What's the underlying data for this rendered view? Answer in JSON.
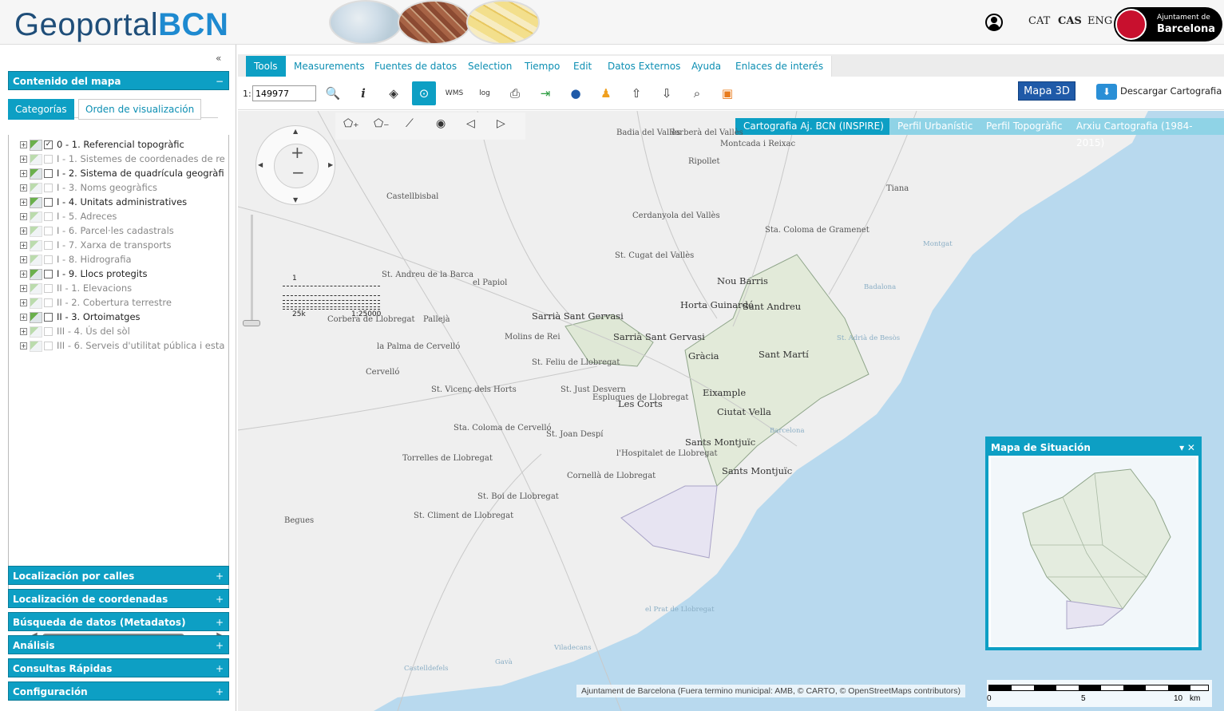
{
  "header": {
    "logo_part1": "Geoportal",
    "logo_part2": "BCN",
    "languages": [
      "CAT",
      "CAS",
      "ENG"
    ],
    "ajuntament_line1": "Ajuntament de",
    "ajuntament_line2": "Barcelona",
    "collapse_left": "«",
    "collapse_top": "︽"
  },
  "sidebar": {
    "contenido_title": "Contenido del mapa",
    "contenido_toggle": "−",
    "tabs": [
      "Categorías",
      "Orden de visualización"
    ],
    "layers": [
      {
        "label": "0 - 1. Referencial topogràfic",
        "checked": true,
        "enabled": true
      },
      {
        "label": "I - 1. Sistemes de coordenades de re",
        "checked": false,
        "enabled": false
      },
      {
        "label": "I - 2. Sistema de quadrícula geogràfi",
        "checked": false,
        "enabled": true
      },
      {
        "label": "I - 3. Noms geogràfics",
        "checked": false,
        "enabled": false
      },
      {
        "label": "I - 4. Unitats administratives",
        "checked": false,
        "enabled": true
      },
      {
        "label": "I - 5. Adreces",
        "checked": false,
        "enabled": false
      },
      {
        "label": "I - 6. Parcel·les cadastrals",
        "checked": false,
        "enabled": false
      },
      {
        "label": "I - 7. Xarxa de transports",
        "checked": false,
        "enabled": false
      },
      {
        "label": "I - 8. Hidrografia",
        "checked": false,
        "enabled": false
      },
      {
        "label": "I - 9. Llocs protegits",
        "checked": false,
        "enabled": true
      },
      {
        "label": "II - 1. Elevacions",
        "checked": false,
        "enabled": false
      },
      {
        "label": "II - 2. Cobertura terrestre",
        "checked": false,
        "enabled": false
      },
      {
        "label": "II - 3. Ortoimatges",
        "checked": false,
        "enabled": true
      },
      {
        "label": "III - 4. Ús del sòl",
        "checked": false,
        "enabled": false
      },
      {
        "label": "III - 6. Serveis d'utilitat pública i esta",
        "checked": false,
        "enabled": false
      }
    ],
    "panels": [
      "Localización por calles",
      "Localización de coordenadas",
      "Búsqueda de datos (Metadatos)",
      "Análisis",
      "Consultas Rápidas",
      "Configuración"
    ],
    "panel_toggle": "+"
  },
  "menu": {
    "tabs": [
      "Tools",
      "Measurements",
      "Fuentes de datos",
      "Selection",
      "Tiempo",
      "Edit",
      "Datos Externos",
      "Ayuda",
      "Enlaces de interés"
    ],
    "active": "Tools"
  },
  "toolbar": {
    "scale_prefix": "1:",
    "scale_value": "149977",
    "btn_3d": "Mapa 3D",
    "descargar": "Descargar Cartografia"
  },
  "map": {
    "cart_tabs": [
      "Cartografia Aj. BCN (INSPIRE)",
      "Perfil Urbanístic",
      "Perfil Topogràfic",
      "Arxiu Cartografia (1984-2015)"
    ],
    "scale_legend": {
      "top": "1",
      "left": "25k",
      "right": "1:25000"
    },
    "labels": {
      "badia": "Badia del Vallès",
      "barbera": "Barberà del Vallès",
      "montcada": "Montcada i Reixac",
      "ripollet": "Ripollet",
      "castellbisbal": "Castellbisbal",
      "cerdanyola": "Cerdanyola del Vallès",
      "tiana": "Tiana",
      "montgat": "Montgat",
      "badalona": "Badalona",
      "colomagramenet": "Sta. Coloma de Gramenet",
      "cugat": "St. Cugat del Vallès",
      "andreu_barca": "St. Andreu de la Barca",
      "papiol": "el Papiol",
      "noubarris": "Nou Barris",
      "horta": "Horta Guinardó",
      "santandreu": "Sant Andreu",
      "sarria1": "Sarrià Sant Gervasi",
      "sarria2": "Sarrià Sant Gervasi",
      "gracia": "Gràcia",
      "santmarti": "Sant Martí",
      "adria": "St. Adrià de Besòs",
      "corbera": "Corbera de Llobregat",
      "pallejà": "Pallejà",
      "palma": "la Palma de Cervelló",
      "molins": "Molins de Rei",
      "feliu": "St. Feliu de Llobregat",
      "cervello": "Cervelló",
      "vicenc": "St. Vicenç dels Horts",
      "justdesvern": "St. Just Desvern",
      "esplugues": "Esplugues de Llobregat",
      "lescorts": "Les Corts",
      "eixample": "Eixample",
      "ciutatvella": "Ciutat Vella",
      "barcelona_sea": "Barcelona",
      "colomacervello": "Sta. Coloma de Cervelló",
      "joandespi": "St. Joan Despí",
      "hospitalet": "l'Hospitalet de Llobregat",
      "santsmontjuic": "Sants Montjuïc",
      "santsmontjuic2": "Sants Montjuïc",
      "torrelles": "Torrelles de Llobregat",
      "cornella": "Cornellà de Llobregat",
      "boi": "St. Boi de Llobregat",
      "climent": "St. Climent de Llobregat",
      "begues": "Begues",
      "pratllobregat": "el Prat de Llobregat",
      "viladecans": "Viladecans",
      "castelldefels": "Castelldefels",
      "gava": "Gavà"
    },
    "attribution": "Ajuntament de Barcelona (Fuera termino municipal: AMB, © CARTO, © OpenStreetMaps contributors)",
    "scalebar": {
      "n0": "0",
      "n5": "5",
      "n10": "10",
      "unit": "km"
    },
    "minimap_title": "Mapa de Situación",
    "minimap_controls": "▾ ✕"
  },
  "colors": {
    "accent": "#0d9fc4",
    "sea": "#b8d9ee",
    "brand_dark": "#1f4e79",
    "brand_light": "#1e8ad0",
    "map_3d": "#1f5aa8"
  }
}
